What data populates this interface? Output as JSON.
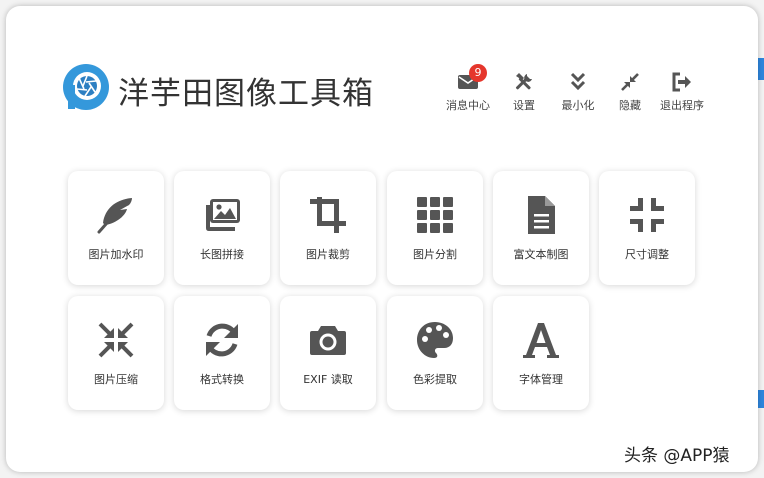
{
  "app": {
    "title": "洋芋田图像工具箱"
  },
  "toolbar": {
    "messages": {
      "label": "消息中心",
      "badge": "9",
      "icon": "envelope-icon"
    },
    "settings": {
      "label": "设置",
      "icon": "tools-icon"
    },
    "minimize": {
      "label": "最小化",
      "icon": "double-chevron-down-icon"
    },
    "hide": {
      "label": "隐藏",
      "icon": "compress-arrows-icon"
    },
    "exit": {
      "label": "退出程序",
      "icon": "sign-out-icon"
    }
  },
  "tools": [
    {
      "label": "图片加水印",
      "icon": "feather-icon"
    },
    {
      "label": "长图拼接",
      "icon": "images-icon"
    },
    {
      "label": "图片裁剪",
      "icon": "crop-icon"
    },
    {
      "label": "图片分割",
      "icon": "grid-icon"
    },
    {
      "label": "富文本制图",
      "icon": "document-icon"
    },
    {
      "label": "尺寸调整",
      "icon": "compress-icon"
    },
    {
      "label": "图片压缩",
      "icon": "compress-arrows-icon"
    },
    {
      "label": "格式转换",
      "icon": "sync-icon"
    },
    {
      "label": "EXIF 读取",
      "icon": "camera-icon"
    },
    {
      "label": "色彩提取",
      "icon": "palette-icon"
    },
    {
      "label": "字体管理",
      "icon": "font-icon"
    }
  ],
  "watermark": "头条 @APP猿",
  "colors": {
    "icon": "#555555",
    "badge": "#e5362c",
    "logo": "#3498db",
    "accent_edge": "#2e86de"
  }
}
